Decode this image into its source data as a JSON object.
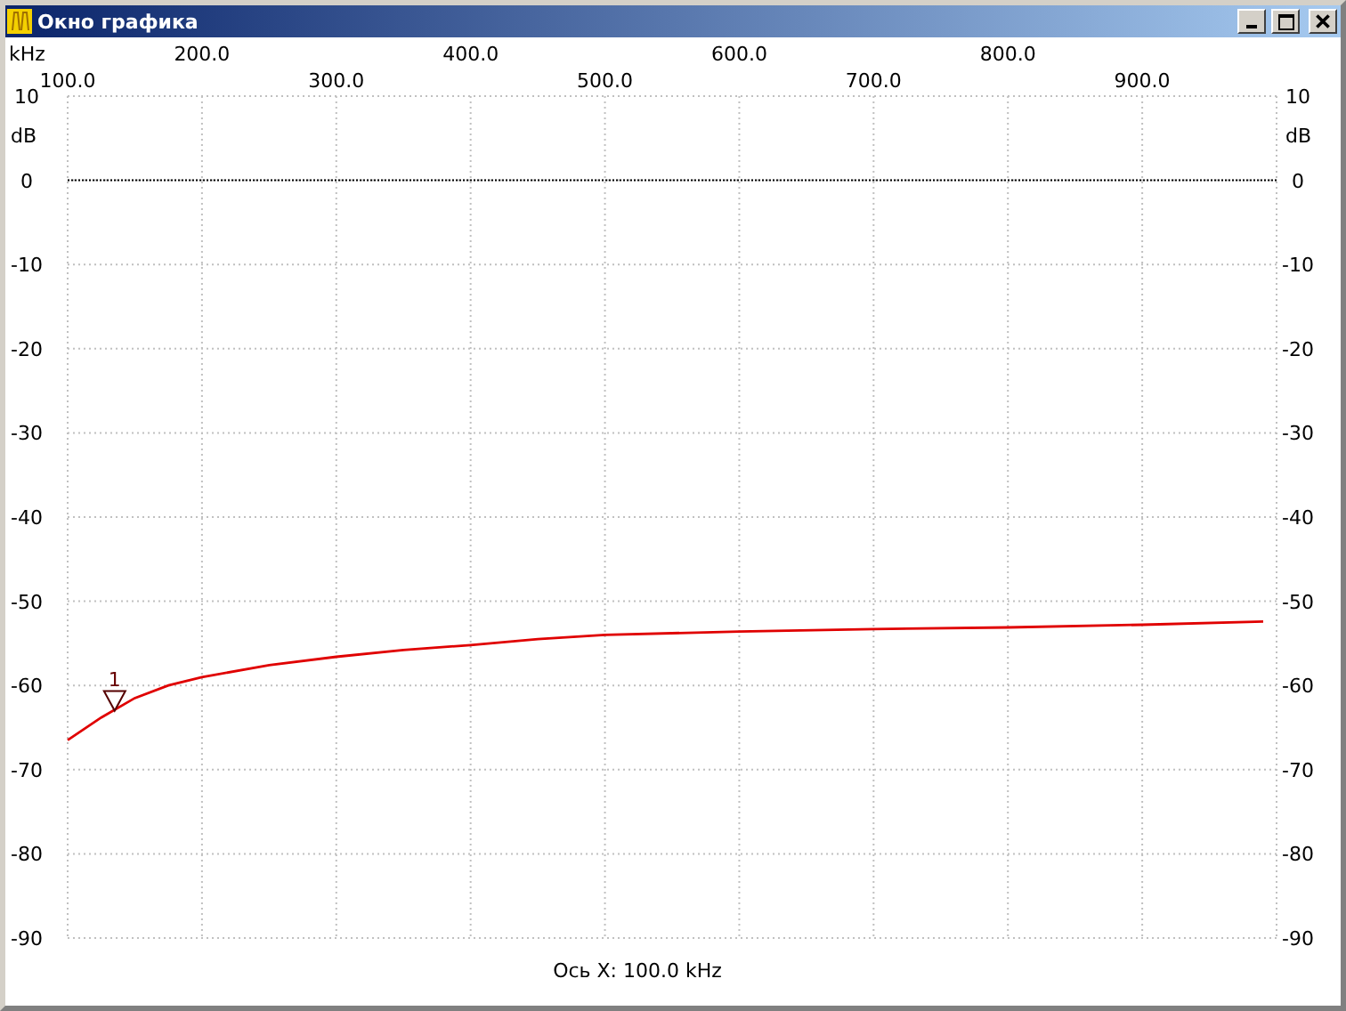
{
  "window": {
    "title": "Окно графика"
  },
  "chart": {
    "chart_data": {
      "type": "line",
      "xlabel": "kHz",
      "ylabel": "dB",
      "grid": true,
      "x": [
        100,
        125,
        150,
        175,
        200,
        250,
        300,
        350,
        400,
        450,
        500,
        600,
        700,
        800,
        900,
        990
      ],
      "series": [
        {
          "color": "#e00000",
          "values": [
            -66.5,
            -63.8,
            -61.5,
            -60,
            -59,
            -57.6,
            -56.6,
            -55.8,
            -55.2,
            -54.5,
            -54,
            -53.6,
            -53.3,
            -53.1,
            -52.8,
            -52.4
          ]
        }
      ],
      "xlim": [
        100,
        1000
      ],
      "ylim": [
        -90,
        10
      ],
      "xticks": [
        {
          "value": 100,
          "label": "100.0"
        },
        {
          "value": 300,
          "label": "300.0"
        },
        {
          "value": 500,
          "label": "500.0"
        },
        {
          "value": 700,
          "label": "700.0"
        },
        {
          "value": 900,
          "label": "900.0"
        }
      ],
      "yticks": [
        10,
        0,
        -10,
        -20,
        -30,
        -40,
        -50,
        -60,
        -70,
        -80,
        -90
      ],
      "ref_lines": [
        {
          "axis": "y",
          "value": 0
        }
      ],
      "annotations": [
        {
          "x": 135,
          "y": -63,
          "text": "1"
        }
      ]
    },
    "upper_scale": [
      "200.0",
      "400.0",
      "600.0",
      "800.0"
    ],
    "left_scale": [
      "10",
      "0",
      "-10",
      "-20",
      "-30",
      "-40",
      "-50",
      "-60",
      "-70",
      "-80",
      "-90"
    ],
    "left_unit": "dB"
  },
  "status": "Ось X: 100.0 kHz"
}
